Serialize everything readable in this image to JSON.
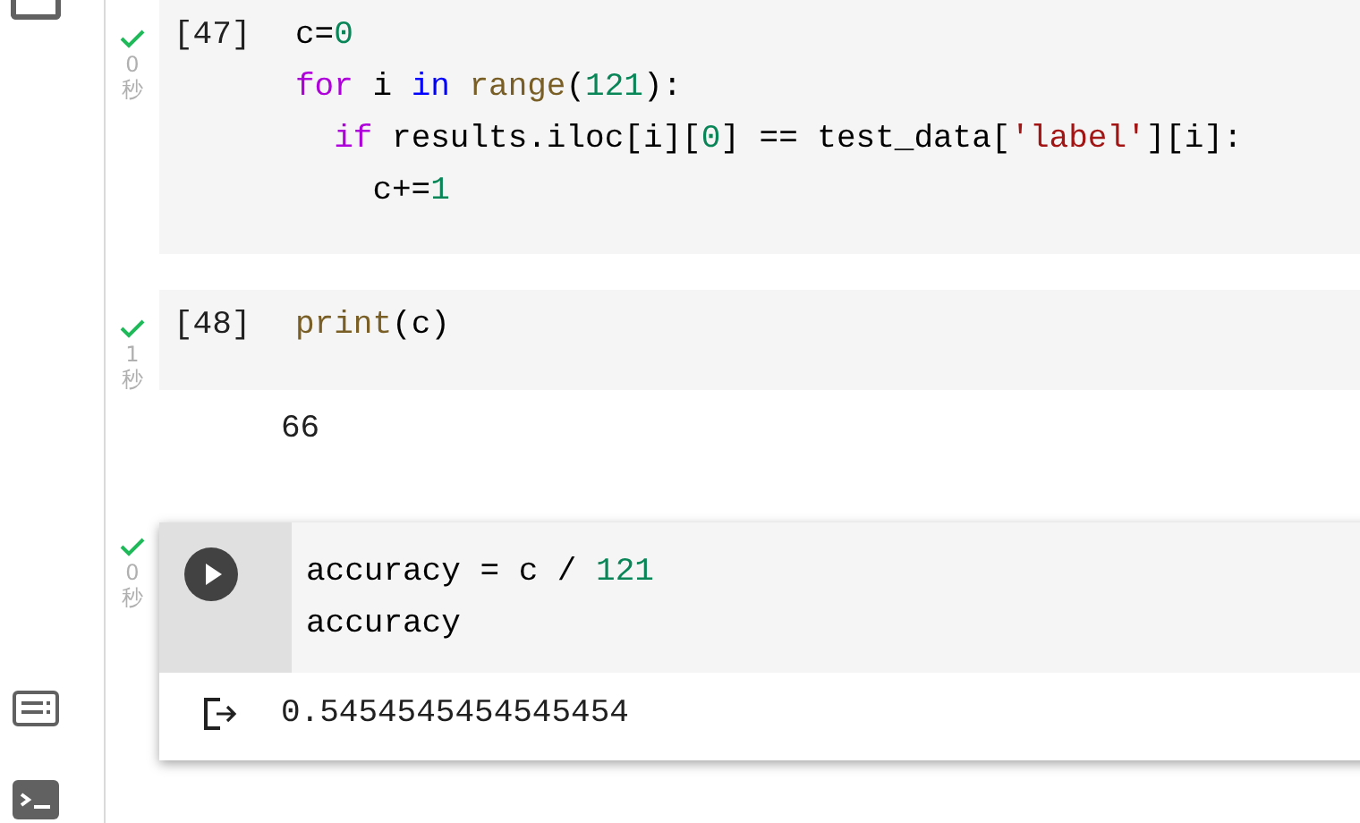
{
  "cells": [
    {
      "prompt": "[47]",
      "status": {
        "done": true,
        "time": "0",
        "unit": "秒"
      },
      "focused": false,
      "lines": [
        [
          {
            "kind": "plain",
            "text": "c="
          },
          {
            "kind": "number",
            "text": "0"
          }
        ],
        [
          {
            "kind": "keyword",
            "text": "for"
          },
          {
            "kind": "plain",
            "text": " i "
          },
          {
            "kind": "operator",
            "text": "in "
          },
          {
            "kind": "builtin",
            "text": "range"
          },
          {
            "kind": "plain",
            "text": "("
          },
          {
            "kind": "number",
            "text": "121"
          },
          {
            "kind": "plain",
            "text": "):"
          }
        ],
        [
          {
            "kind": "keyword",
            "text": "  if"
          },
          {
            "kind": "plain",
            "text": " results.iloc[i]["
          },
          {
            "kind": "number",
            "text": "0"
          },
          {
            "kind": "plain",
            "text": "] == test_data["
          },
          {
            "kind": "string",
            "text": "'label'"
          },
          {
            "kind": "plain",
            "text": "][i]:"
          }
        ],
        [
          {
            "kind": "plain",
            "text": "    c+="
          },
          {
            "kind": "number",
            "text": "1"
          }
        ]
      ]
    },
    {
      "prompt": "[48]",
      "status": {
        "done": true,
        "time": "1",
        "unit": "秒"
      },
      "focused": false,
      "lines": [
        [
          {
            "kind": "builtin",
            "text": "print"
          },
          {
            "kind": "plain",
            "text": "(c)"
          }
        ]
      ],
      "output": "66"
    },
    {
      "status": {
        "done": true,
        "time": "0",
        "unit": "秒"
      },
      "focused": true,
      "lines": [
        [
          {
            "kind": "plain",
            "text": "accuracy = c / "
          },
          {
            "kind": "number",
            "text": "121"
          }
        ],
        [
          {
            "kind": "plain",
            "text": "accuracy"
          }
        ]
      ],
      "output": "0.5454545454545454"
    }
  ]
}
